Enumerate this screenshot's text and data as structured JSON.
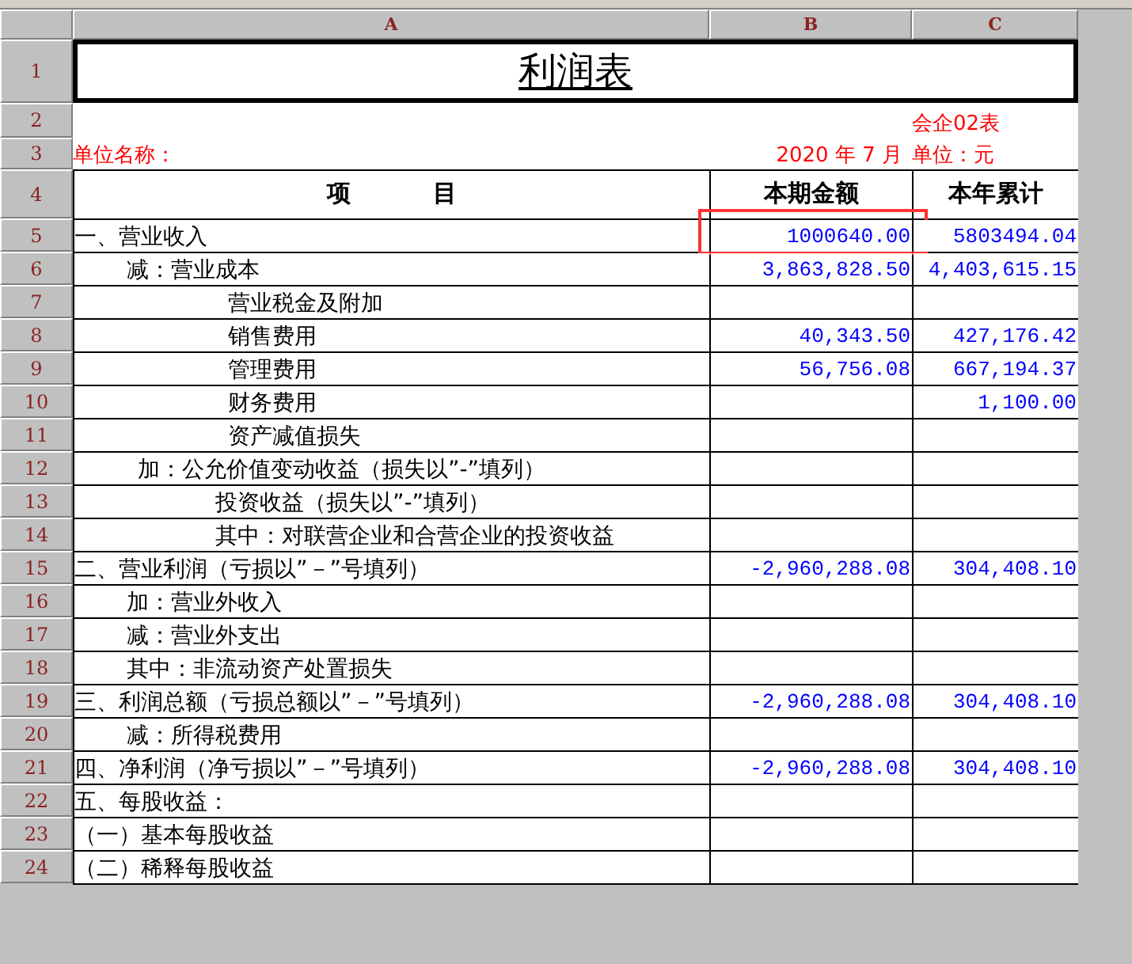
{
  "column_headers": [
    "A",
    "B",
    "C"
  ],
  "row_numbers": [
    "1",
    "2",
    "3",
    "4"
  ],
  "title": "利润表",
  "form_code": "会企02表",
  "unit_name_label": "单位名称：",
  "period": "2020 年 7 月",
  "unit": "单位：元",
  "header": {
    "item": "项          目",
    "current": "本期金额",
    "ytd": "本年累计"
  },
  "rows": [
    {
      "no": "5",
      "kind": "section",
      "item": "一、营业收入",
      "current": "1000640.00",
      "ytd": "5803494.04",
      "highlight": true
    },
    {
      "no": "6",
      "kind": "adjust",
      "item": "减：营业成本",
      "current": "3,863,828.50",
      "ytd": "4,403,615.15",
      "highlight": false
    },
    {
      "no": "7",
      "kind": "detail",
      "item": "营业税金及附加",
      "highlight": false
    },
    {
      "no": "8",
      "kind": "detail",
      "item": "销售费用",
      "current": "40,343.50",
      "ytd": "427,176.42",
      "highlight": false
    },
    {
      "no": "9",
      "kind": "detail",
      "item": "管理费用",
      "current": "56,756.08",
      "ytd": "667,194.37",
      "highlight": false
    },
    {
      "no": "10",
      "kind": "detail",
      "item": "财务费用",
      "ytd": "1,100.00",
      "highlight": false
    },
    {
      "no": "11",
      "kind": "detail",
      "item": "资产减值损失",
      "highlight": false
    },
    {
      "no": "12",
      "kind": "plus",
      "item": "加：公允价值变动收益（损失以”-”填列）",
      "highlight": false
    },
    {
      "no": "13",
      "kind": "sub",
      "item": "投资收益（损失以”-”填列）",
      "highlight": false
    },
    {
      "no": "14",
      "kind": "sub",
      "item": "其中：对联营企业和合营企业的投资收益",
      "highlight": false
    },
    {
      "no": "15",
      "kind": "section",
      "item": "二、营业利润（亏损以”－”号填列）",
      "current": "-2,960,288.08",
      "ytd": "304,408.10",
      "highlight": false
    },
    {
      "no": "16",
      "kind": "adjust",
      "item": "加：营业外收入",
      "highlight": false
    },
    {
      "no": "17",
      "kind": "adjust",
      "item": "减：营业外支出",
      "highlight": false
    },
    {
      "no": "18",
      "kind": "adjust",
      "item": "其中：非流动资产处置损失",
      "highlight": false
    },
    {
      "no": "19",
      "kind": "section",
      "item": "三、利润总额（亏损总额以”－”号填列）",
      "current": "-2,960,288.08",
      "ytd": "304,408.10",
      "highlight": false
    },
    {
      "no": "20",
      "kind": "adjust",
      "item": "减：所得税费用",
      "highlight": false
    },
    {
      "no": "21",
      "kind": "section",
      "item": "四、净利润（净亏损以”－”号填列）",
      "current": "-2,960,288.08",
      "ytd": "304,408.10",
      "highlight": false
    },
    {
      "no": "22",
      "kind": "section",
      "item": "五、每股收益：",
      "highlight": false
    },
    {
      "no": "23",
      "kind": "section",
      "item": "（一）基本每股收益",
      "highlight": false
    },
    {
      "no": "24",
      "kind": "section",
      "item": "（二）稀释每股收益",
      "highlight": false
    }
  ]
}
